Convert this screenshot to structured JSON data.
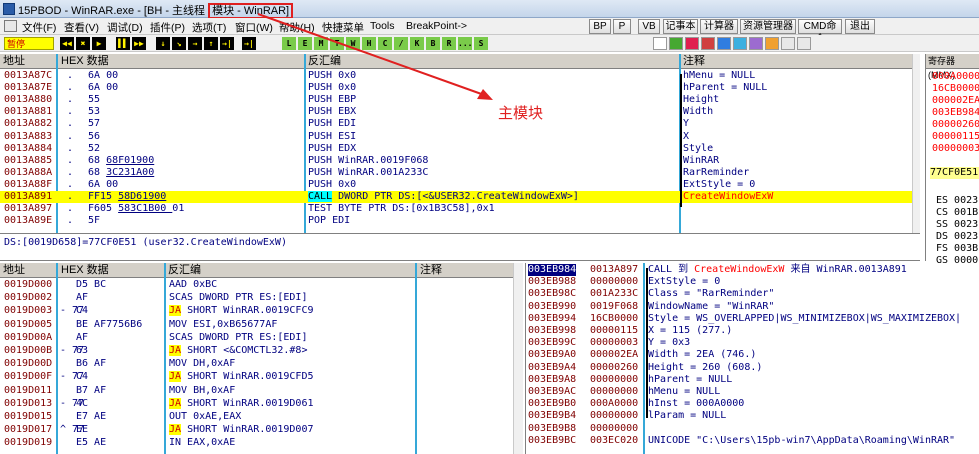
{
  "window": {
    "title": "15PBOD - WinRAR.exe - [BH - 主线程 ",
    "title_module": "模块 - WinRAR]"
  },
  "menu": {
    "items": [
      "文件(F)",
      "查看(V)",
      "调试(D)",
      "插件(P)",
      "选项(T)",
      "窗口(W)",
      "帮助(H)",
      "快捷菜单",
      "Tools",
      "BreakPoint->"
    ],
    "right_buttons": [
      "BP",
      "P",
      "VB",
      "记事本",
      "计算器",
      "资源管理器",
      "CMD命令",
      "退出"
    ]
  },
  "toolbar": {
    "state": "暂停",
    "buttons": [
      "◀◀",
      "✖",
      "▶",
      "▌▌",
      "▶▶",
      "↓",
      "↘",
      "→",
      "↑",
      "→|",
      "L",
      "E",
      "M",
      "T",
      "W",
      "H",
      "C",
      "/",
      "K",
      "B",
      "R",
      "...",
      "S"
    ]
  },
  "annotation": "主模块",
  "disasm": {
    "headers": [
      "地址",
      "HEX 数据",
      "反汇编",
      "注释"
    ],
    "rows": [
      {
        "addr": "0013A87C",
        "mark": ".",
        "hex": "6A 00",
        "asm": "PUSH 0x0",
        "cmt": "hMenu = NULL"
      },
      {
        "addr": "0013A87E",
        "mark": ".",
        "hex": "6A 00",
        "asm": "PUSH 0x0",
        "cmt": "hParent = NULL"
      },
      {
        "addr": "0013A880",
        "mark": ".",
        "hex": "55",
        "asm": "PUSH EBP",
        "cmt": "Height"
      },
      {
        "addr": "0013A881",
        "mark": ".",
        "hex": "53",
        "asm": "PUSH EBX",
        "cmt": "Width"
      },
      {
        "addr": "0013A882",
        "mark": ".",
        "hex": "57",
        "asm": "PUSH EDI",
        "cmt": "Y"
      },
      {
        "addr": "0013A883",
        "mark": ".",
        "hex": "56",
        "asm": "PUSH ESI",
        "cmt": "X"
      },
      {
        "addr": "0013A884",
        "mark": ".",
        "hex": "52",
        "asm": "PUSH EDX",
        "cmt": "Style"
      },
      {
        "addr": "0013A885",
        "mark": ".",
        "hex": "68 68F01900",
        "asm": "PUSH WinRAR.0019F068",
        "cmt": "WinRAR"
      },
      {
        "addr": "0013A88A",
        "mark": ".",
        "hex": "68 3C231A00",
        "asm": "PUSH WinRAR.001A233C",
        "cmt": "RarReminder"
      },
      {
        "addr": "0013A88F",
        "mark": ".",
        "hex": "6A 00",
        "asm": "PUSH 0x0",
        "cmt": "ExtStyle = 0"
      },
      {
        "addr": "0013A891",
        "mark": ".",
        "hex": "FF15 58D61900",
        "asm": "CALL DWORD PTR DS:[<&USER32.CreateWindowExW>]",
        "cmt": "CreateWindowExW"
      },
      {
        "addr": "0013A897",
        "mark": ".",
        "hex": "F605 583C1B00 01",
        "asm": "TEST BYTE PTR DS:[0x1B3C58],0x1",
        "cmt": ""
      },
      {
        "addr": "0013A89E",
        "mark": ".",
        "hex": "5F",
        "asm": "POP EDI",
        "cmt": ""
      }
    ],
    "info": "DS:[0019D658]=77CF0E51 (user32.CreateWindowExW)"
  },
  "registers": {
    "header": "寄存器 (MMX)",
    "values": [
      "000A0000",
      "16CB0000",
      "000002EA",
      "003EB984",
      "00000260",
      "00000115",
      "00000003"
    ],
    "eip": "77CF0E51",
    "segs": [
      "ES 0023",
      "CS 001B",
      "SS 0023",
      "DS 0023",
      "FS 003B",
      "GS 0000"
    ]
  },
  "dump": {
    "headers": [
      "地址",
      "HEX 数据",
      "反汇编",
      "注释"
    ],
    "rows": [
      {
        "addr": "0019D000",
        "mark": "",
        "hex": "D5 BC",
        "asm": "AAD 0xBC",
        "ja": ""
      },
      {
        "addr": "0019D002",
        "mark": "",
        "hex": "AF",
        "asm": "SCAS DWORD PTR ES:[EDI]",
        "ja": ""
      },
      {
        "addr": "0019D003",
        "mark": "- 77",
        "hex": "C4",
        "asm": " SHORT WinRAR.0019CFC9",
        "ja": "JA"
      },
      {
        "addr": "0019D005",
        "mark": "",
        "hex": "BE AF7756B6",
        "asm": "MOV ESI,0xB65677AF",
        "ja": ""
      },
      {
        "addr": "0019D00A",
        "mark": "",
        "hex": "AF",
        "asm": "SCAS DWORD PTR ES:[EDI]",
        "ja": ""
      },
      {
        "addr": "0019D00B",
        "mark": "- 77",
        "hex": "63",
        "asm": " SHORT <&COMCTL32.#8>",
        "ja": "JA"
      },
      {
        "addr": "0019D00D",
        "mark": "",
        "hex": "B6 AF",
        "asm": "MOV DH,0xAF",
        "ja": ""
      },
      {
        "addr": "0019D00F",
        "mark": "- 77",
        "hex": "C4",
        "asm": " SHORT WinRAR.0019CFD5",
        "ja": "JA"
      },
      {
        "addr": "0019D011",
        "mark": "",
        "hex": "B7 AF",
        "asm": "MOV BH,0xAF",
        "ja": ""
      },
      {
        "addr": "0019D013",
        "mark": "- 77",
        "hex": "4C",
        "asm": " SHORT WinRAR.0019D061",
        "ja": "JA"
      },
      {
        "addr": "0019D015",
        "mark": "",
        "hex": "E7 AE",
        "asm": "OUT 0xAE,EAX",
        "ja": ""
      },
      {
        "addr": "0019D017",
        "mark": "^ 77",
        "hex": "EE",
        "asm": " SHORT WinRAR.0019D007",
        "ja": "JA"
      },
      {
        "addr": "0019D019",
        "mark": "",
        "hex": "E5 AE",
        "asm": "IN EAX,0xAE",
        "ja": ""
      }
    ]
  },
  "stack": {
    "rows": [
      {
        "addr": "003EB984",
        "val": "0013A897",
        "cmt_pre": "CALL 到 ",
        "cmt_red": "CreateWindowExW",
        "cmt_mid": " 来自 ",
        "cmt_post": "WinRAR.0013A891",
        "first": true
      },
      {
        "addr": "003EB988",
        "val": "00000000",
        "cmt_pre": "ExtStyle = 0"
      },
      {
        "addr": "003EB98C",
        "val": "001A233C",
        "cmt_pre": "Class = \"RarReminder\""
      },
      {
        "addr": "003EB990",
        "val": "0019F068",
        "cmt_pre": "WindowName = \"WinRAR\""
      },
      {
        "addr": "003EB994",
        "val": "16CB0000",
        "cmt_pre": "Style = WS_OVERLAPPED|WS_MINIMIZEBOX|WS_MAXIMIZEBOX|"
      },
      {
        "addr": "003EB998",
        "val": "00000115",
        "cmt_pre": "X = 115 (277.)"
      },
      {
        "addr": "003EB99C",
        "val": "00000003",
        "cmt_pre": "Y = 0x3"
      },
      {
        "addr": "003EB9A0",
        "val": "000002EA",
        "cmt_pre": "Width = 2EA (746.)"
      },
      {
        "addr": "003EB9A4",
        "val": "00000260",
        "cmt_pre": "Height = 260 (608.)"
      },
      {
        "addr": "003EB9A8",
        "val": "00000000",
        "cmt_pre": "hParent = NULL"
      },
      {
        "addr": "003EB9AC",
        "val": "00000000",
        "cmt_pre": "hMenu = NULL"
      },
      {
        "addr": "003EB9B0",
        "val": "000A0000",
        "cmt_pre": "hInst = 000A0000"
      },
      {
        "addr": "003EB9B4",
        "val": "00000000",
        "cmt_pre": "lParam = NULL"
      },
      {
        "addr": "003EB9B8",
        "val": "00000000",
        "cmt_pre": ""
      },
      {
        "addr": "003EB9BC",
        "val": "003EC020",
        "cmt_pre": "UNICODE \"C:\\Users\\15pb-win7\\AppData\\Roaming\\WinRAR\""
      }
    ]
  }
}
